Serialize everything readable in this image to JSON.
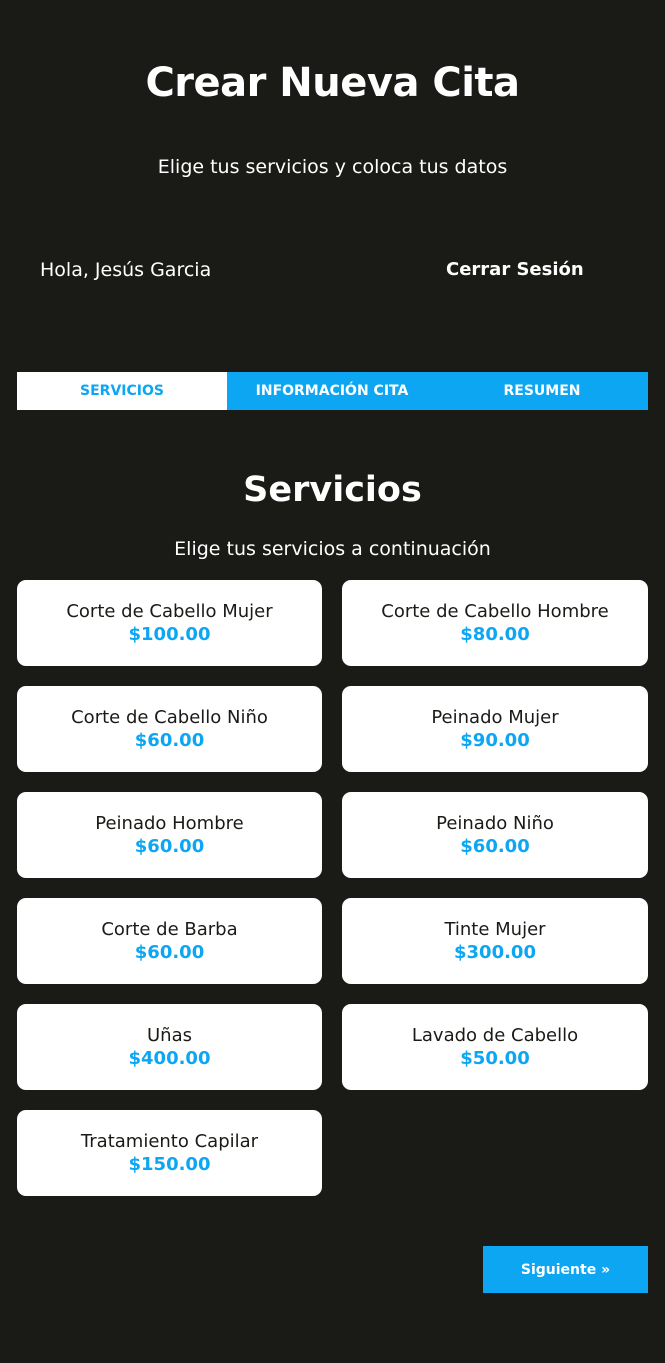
{
  "header": {
    "title": "Crear Nueva Cita",
    "subtitle": "Elige tus servicios y coloca tus datos"
  },
  "session": {
    "greeting": "Hola, Jesús Garcia",
    "logout_label": "Cerrar Sesión"
  },
  "tabs": [
    {
      "label": "SERVICIOS",
      "active": true
    },
    {
      "label": "INFORMACIÓN CITA",
      "active": false
    },
    {
      "label": "RESUMEN",
      "active": false
    }
  ],
  "section": {
    "title": "Servicios",
    "subtitle": "Elige tus servicios a continuación"
  },
  "services": [
    {
      "name": "Corte de Cabello Mujer",
      "price": "$100.00"
    },
    {
      "name": "Corte de Cabello Hombre",
      "price": "$80.00"
    },
    {
      "name": "Corte de Cabello Niño",
      "price": "$60.00"
    },
    {
      "name": "Peinado Mujer",
      "price": "$90.00"
    },
    {
      "name": "Peinado Hombre",
      "price": "$60.00"
    },
    {
      "name": "Peinado Niño",
      "price": "$60.00"
    },
    {
      "name": "Corte de Barba",
      "price": "$60.00"
    },
    {
      "name": "Tinte Mujer",
      "price": "$300.00"
    },
    {
      "name": "Uñas",
      "price": "$400.00"
    },
    {
      "name": "Lavado de Cabello",
      "price": "$50.00"
    },
    {
      "name": "Tratamiento Capilar",
      "price": "$150.00"
    }
  ],
  "navigation": {
    "next_label": "Siguiente »"
  },
  "colors": {
    "background": "#1a1a16",
    "accent": "#0da6f3",
    "card": "#ffffff"
  }
}
